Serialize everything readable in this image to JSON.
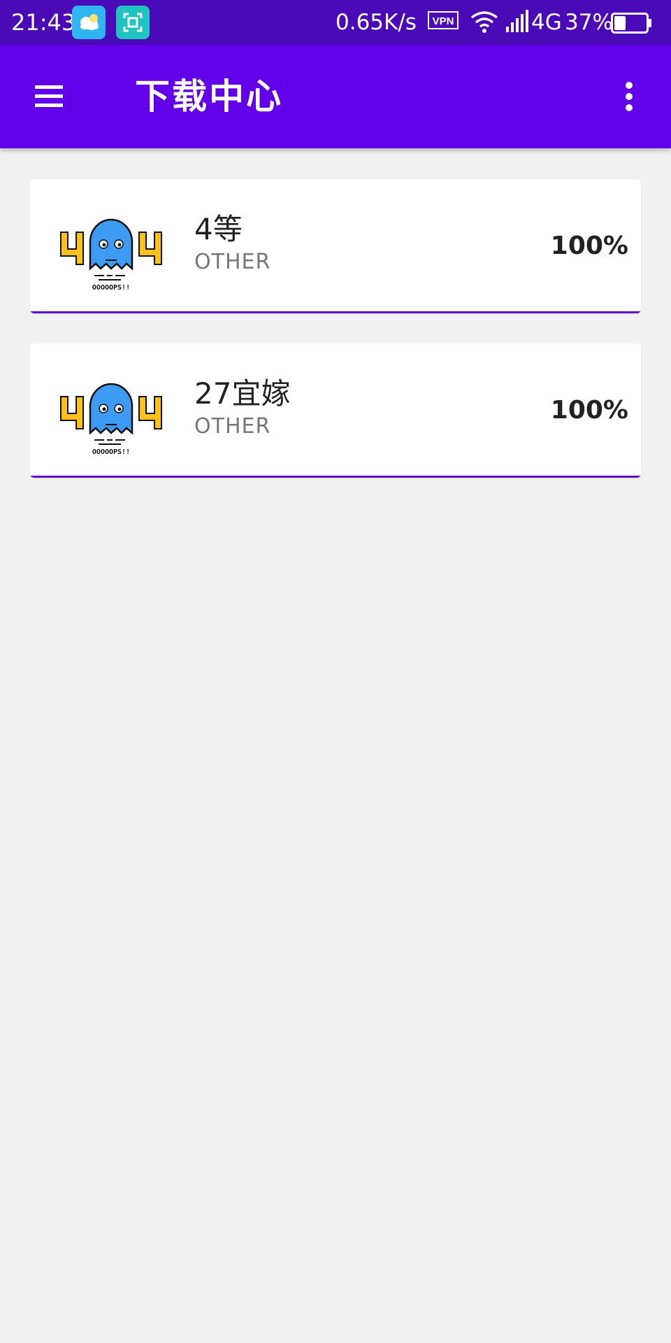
{
  "status_bar": {
    "time": "21:43",
    "app_icons": [
      "weather-icon",
      "scan-icon"
    ],
    "net_speed": "0.65K/s",
    "vpn_label": "VPN",
    "network": "4G",
    "battery": "37%",
    "battery_level": 0.37
  },
  "toolbar": {
    "title": "下载中心",
    "menu_icon": "hamburger-menu-icon",
    "overflow_icon": "more-vert-icon"
  },
  "downloads": [
    {
      "title": "4等",
      "type": "OTHER",
      "percent": "100%",
      "progress": 1.0,
      "thumbnail_caption": "OOOOOPS!!"
    },
    {
      "title": "27宜嫁",
      "type": "OTHER",
      "percent": "100%",
      "progress": 1.0,
      "thumbnail_caption": "OOOOOPS!!"
    }
  ],
  "colors": {
    "status_bar": "#4a0ab8",
    "toolbar": "#6200ea",
    "background": "#f1f1f1",
    "progress": "#5a13c9"
  }
}
